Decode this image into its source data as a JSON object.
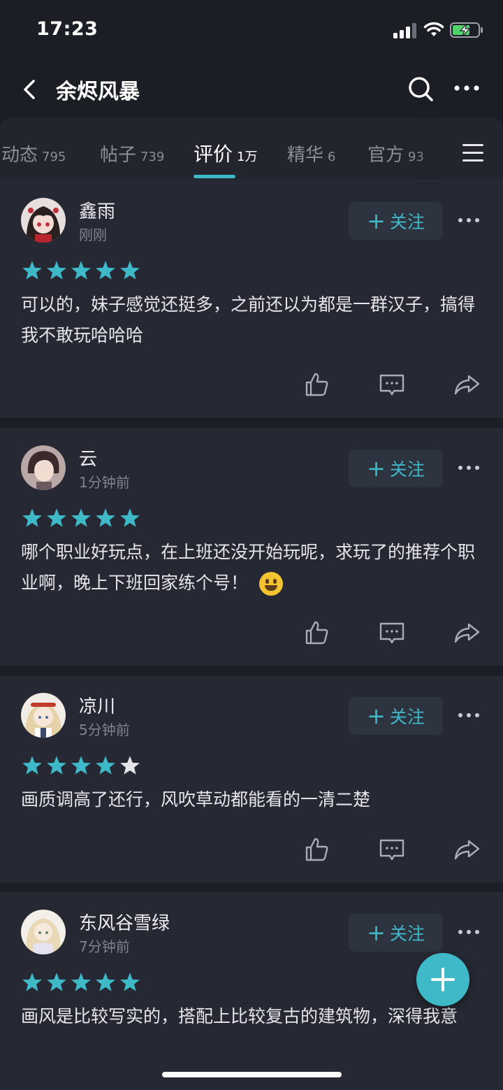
{
  "status_bar": {
    "time": "17:23"
  },
  "nav": {
    "title": "余烬风暴"
  },
  "tabs": [
    {
      "label": "动态",
      "count": "795"
    },
    {
      "label": "帖子",
      "count": "739"
    },
    {
      "label": "评价",
      "count": "1万"
    },
    {
      "label": "精华",
      "count": "6"
    },
    {
      "label": "官方",
      "count": "93"
    }
  ],
  "active_tab": "评价",
  "follow_label": "关注",
  "reviews": [
    {
      "user": "鑫雨",
      "time": "刚刚",
      "rating": 5,
      "text": "可以的，妹子感觉还挺多，之前还以为都是一群汉子，搞得我不敢玩哈哈哈"
    },
    {
      "user": "云",
      "time": "1分钟前",
      "rating": 5,
      "text": "哪个职业好玩点，在上班还没开始玩呢，求玩了的推荐个职业啊，晚上下班回家练个号！"
    },
    {
      "user": "凉川",
      "time": "5分钟前",
      "rating": 4,
      "text": "画质调高了还行，风吹草动都能看的一清二楚"
    },
    {
      "user": "东风谷雪绿",
      "time": "7分钟前",
      "rating": 5,
      "text": "画风是比较写实的，搭配上比较复古的建筑物，深得我意"
    }
  ],
  "colors": {
    "accent": "#3fb8c8",
    "background": "#1c1e26",
    "card": "#262933"
  }
}
